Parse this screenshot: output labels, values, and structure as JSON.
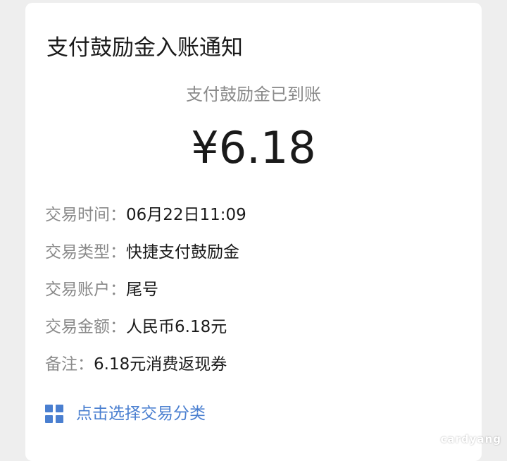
{
  "notification": {
    "title": "支付鼓励金入账通知",
    "subtitle": "支付鼓励金已到账",
    "amount": "¥6.18"
  },
  "details": [
    {
      "label": "交易时间：",
      "value": "06月22日11:09"
    },
    {
      "label": "交易类型：",
      "value": "快捷支付鼓励金"
    },
    {
      "label": "交易账户：",
      "value": "尾号"
    },
    {
      "label": "交易金额：",
      "value": "人民币6.18元"
    },
    {
      "label": "备注：",
      "value": "6.18元消费返现券"
    }
  ],
  "action": {
    "icon": "grid-icon",
    "label": "点击选择交易分类"
  },
  "watermark": "cardyang",
  "colors": {
    "accent": "#4a7fd0",
    "primary_text": "#1a1a1a",
    "secondary_text": "#8a8a8a",
    "card": "#ffffff",
    "background": "#eeeeee"
  }
}
